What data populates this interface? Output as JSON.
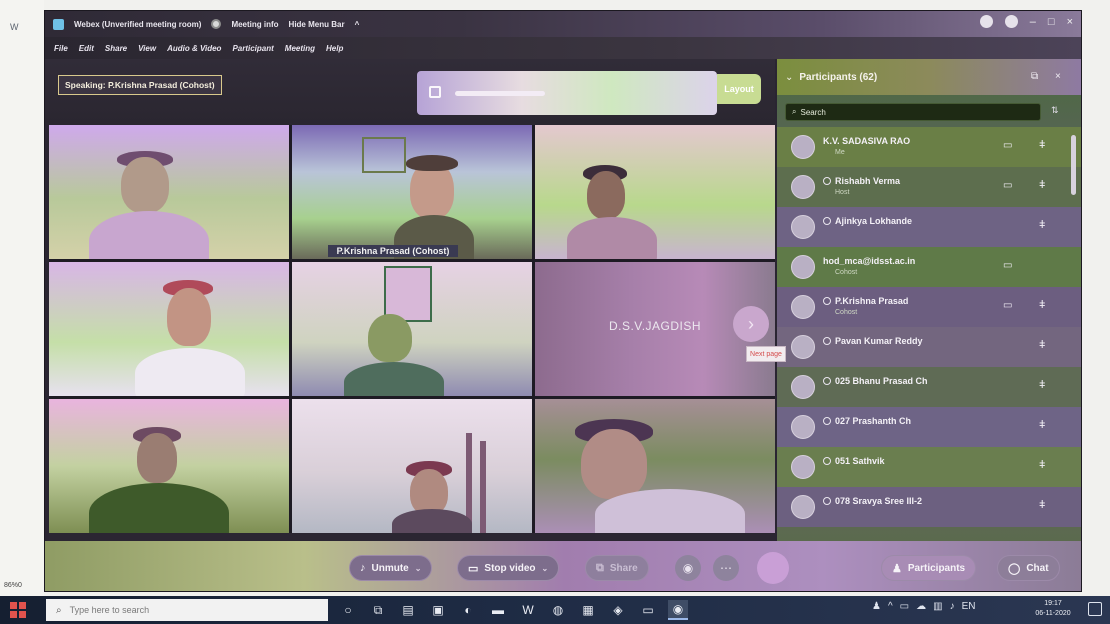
{
  "window": {
    "title": "Webex (Unverified meeting room)",
    "meeting_info_label": "Meeting info",
    "hide_menu_bar_label": "Hide Menu Bar"
  },
  "menu": [
    "File",
    "Edit",
    "Share",
    "View",
    "Audio & Video",
    "Participant",
    "Meeting",
    "Help"
  ],
  "speaking": "Speaking: P.Krishna Prasad (Cohost)",
  "notice_button": "Layout",
  "video_tiles": [
    {
      "name": ""
    },
    {
      "name": "P.Krishna Prasad (Cohost)"
    },
    {
      "name": ""
    },
    {
      "name": ""
    },
    {
      "name": ""
    },
    {
      "name": "D.S.V.JAGDISH"
    },
    {
      "name": ""
    },
    {
      "name": ""
    },
    {
      "name": ""
    }
  ],
  "next_page_tooltip": "Next page",
  "participants_panel": {
    "title": "Participants (62)",
    "search_placeholder": "Search",
    "rows": [
      {
        "name": "K.V. SADASIVA RAO",
        "role": "Me"
      },
      {
        "name": "Rishabh Verma",
        "role": "Host"
      },
      {
        "name": "Ajinkya Lokhande",
        "role": ""
      },
      {
        "name": "hod_mca@idsst.ac.in",
        "role": "Cohost"
      },
      {
        "name": "P.Krishna Prasad",
        "role": "Cohost"
      },
      {
        "name": "Pavan Kumar Reddy",
        "role": ""
      },
      {
        "name": "025 Bhanu Prasad Ch",
        "role": ""
      },
      {
        "name": "027 Prashanth Ch",
        "role": ""
      },
      {
        "name": "051 Sathvik",
        "role": ""
      },
      {
        "name": "078 Sravya Sree III-2",
        "role": ""
      }
    ]
  },
  "controls": {
    "unmute_label": "Unmute",
    "stop_video_label": "Stop video",
    "share_label": "Share",
    "participants_label": "Participants",
    "chat_label": "Chat"
  },
  "taskbar": {
    "search_placeholder": "Type here to search",
    "clock_time": "19:17",
    "clock_date": "06-11-2020",
    "desktop_number": "86%0"
  },
  "colors": {
    "window_bg": "#2a2532",
    "panel_bg": "#6a5b7c",
    "taskbar_bg": "#1e2b44"
  }
}
